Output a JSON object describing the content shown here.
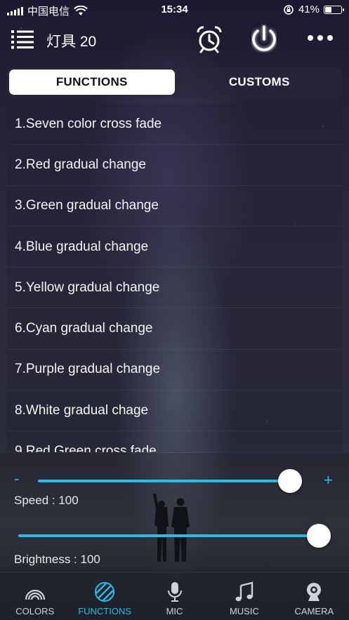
{
  "status_bar": {
    "carrier": "中国电信",
    "time": "15:34",
    "battery_percent": "41%",
    "battery_level": 0.41
  },
  "navbar": {
    "title": "灯具 20"
  },
  "tabs": [
    {
      "label": "FUNCTIONS",
      "active": true
    },
    {
      "label": "CUSTOMS",
      "active": false
    }
  ],
  "functions": [
    "1.Seven color cross fade",
    "2.Red gradual change",
    "3.Green gradual change",
    "4.Blue gradual change",
    "5.Yellow gradual change",
    "6.Cyan gradual change",
    "7.Purple gradual change",
    "8.White gradual chage",
    "9.Red Green cross fade"
  ],
  "speed": {
    "label": "Speed : 100",
    "minus": "-",
    "plus": "+",
    "value_fraction": 0.97
  },
  "brightness": {
    "label": "Brightness : 100",
    "value_fraction": 1.0
  },
  "bottom_tabs": [
    {
      "label": "COLORS",
      "icon": "rainbow-icon",
      "active": false
    },
    {
      "label": "FUNCTIONS",
      "icon": "functions-stripes-icon",
      "active": true
    },
    {
      "label": "MIC",
      "icon": "microphone-icon",
      "active": false
    },
    {
      "label": "MUSIC",
      "icon": "music-note-icon",
      "active": false
    },
    {
      "label": "CAMERA",
      "icon": "camera-icon",
      "active": false
    }
  ],
  "colors": {
    "accent": "#2bbbe6"
  }
}
